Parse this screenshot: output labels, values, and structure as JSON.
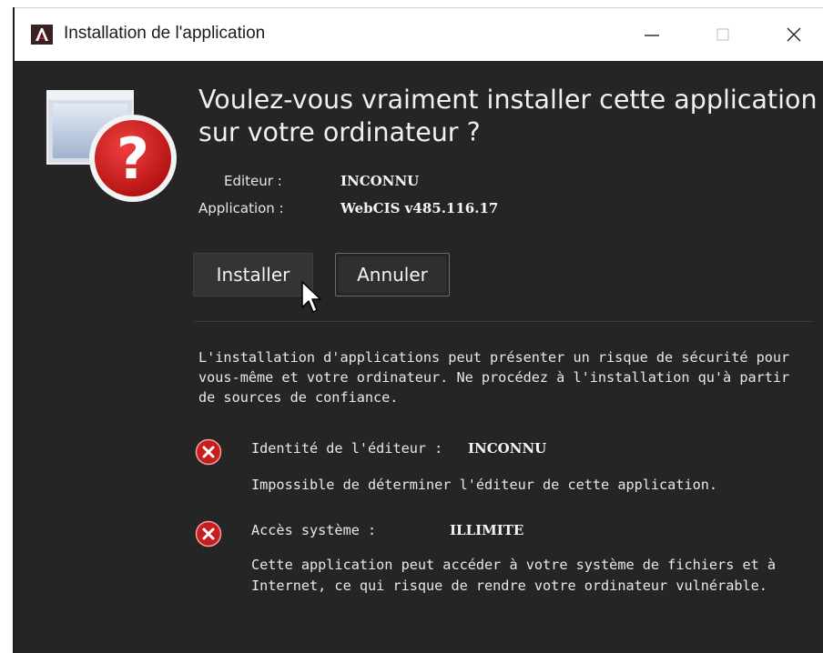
{
  "window": {
    "title": "Installation de l'application",
    "logo_icon": "adobe-air-icon"
  },
  "dialog": {
    "headline": "Voulez-vous vraiment installer cette application sur votre ordinateur ?",
    "app_icon": "application-question-icon",
    "publisher_label": "Editeur :",
    "publisher_value": "INCONNU",
    "application_label": "Application :",
    "application_value": "WebCIS v485.116.17",
    "install_label": "Installer",
    "cancel_label": "Annuler",
    "warning": "L'installation d'applications peut présenter un risque de sécurité pour vous-même et votre ordinateur. Ne procédez à l'installation qu'à partir de sources de confiance.",
    "risks": [
      {
        "icon": "error-x-icon",
        "label": "Identité de l'éditeur :",
        "value": "INCONNU",
        "description": "Impossible de déterminer l'éditeur de cette application."
      },
      {
        "icon": "error-x-icon",
        "label": "Accès système :",
        "value": "ILLIMITE",
        "description": "Cette application peut accéder à votre système de fichiers et à Internet, ce qui risque de rendre votre ordinateur vulnérable."
      }
    ]
  },
  "colors": {
    "background": "#252525",
    "error_red": "#d0201f",
    "text": "#e8e8e8"
  }
}
